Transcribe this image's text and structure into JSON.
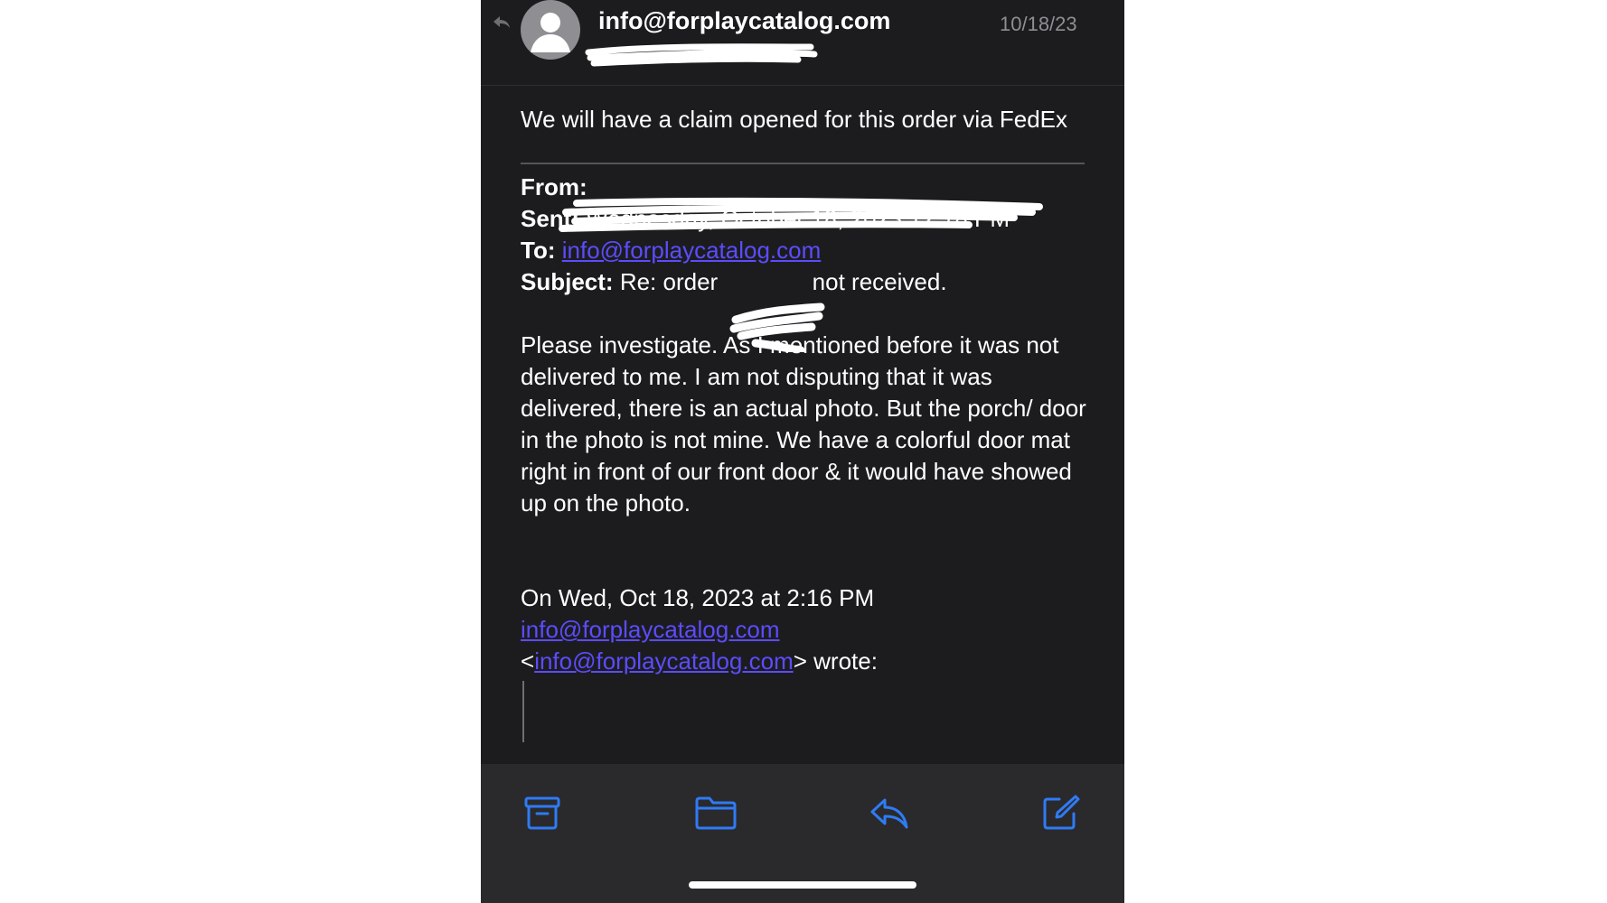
{
  "header": {
    "sender": "info@forplaycatalog.com",
    "date": "10/18/23"
  },
  "message": {
    "intro": "We will have a claim opened for this order via FedEx",
    "from_label": "From:",
    "sent_label": "Sent:",
    "sent_value": "Wednesday, October 18, 2023 12:18 PM",
    "to_label": "To:",
    "to_value": "info@forplaycatalog.com",
    "subject_label": "Subject:",
    "subject_prefix": "Re: order",
    "subject_suffix": "not received.",
    "paragraph": "Please investigate. As I mentioned before it was not delivered to me. I am not disputing that it was delivered, there is an actual photo. But the porch/ door in the photo is not mine. We have a colorful door mat right in front of our front door & it would have showed up on the photo.",
    "quote_intro": "On Wed, Oct 18, 2023 at 2:16 PM",
    "quote_email": "info@forplaycatalog.com",
    "quote_email_angle": "info@forplaycatalog.com",
    "quote_open": "<",
    "quote_close": "> wrote:"
  },
  "toolbar": {
    "icons": [
      "archive-icon",
      "folder-icon",
      "reply-icon",
      "compose-icon"
    ]
  },
  "colors": {
    "background": "#1c1c1e",
    "toolbar": "#2a2a2c",
    "accent": "#2f7bf5",
    "link": "#5b4cff"
  }
}
